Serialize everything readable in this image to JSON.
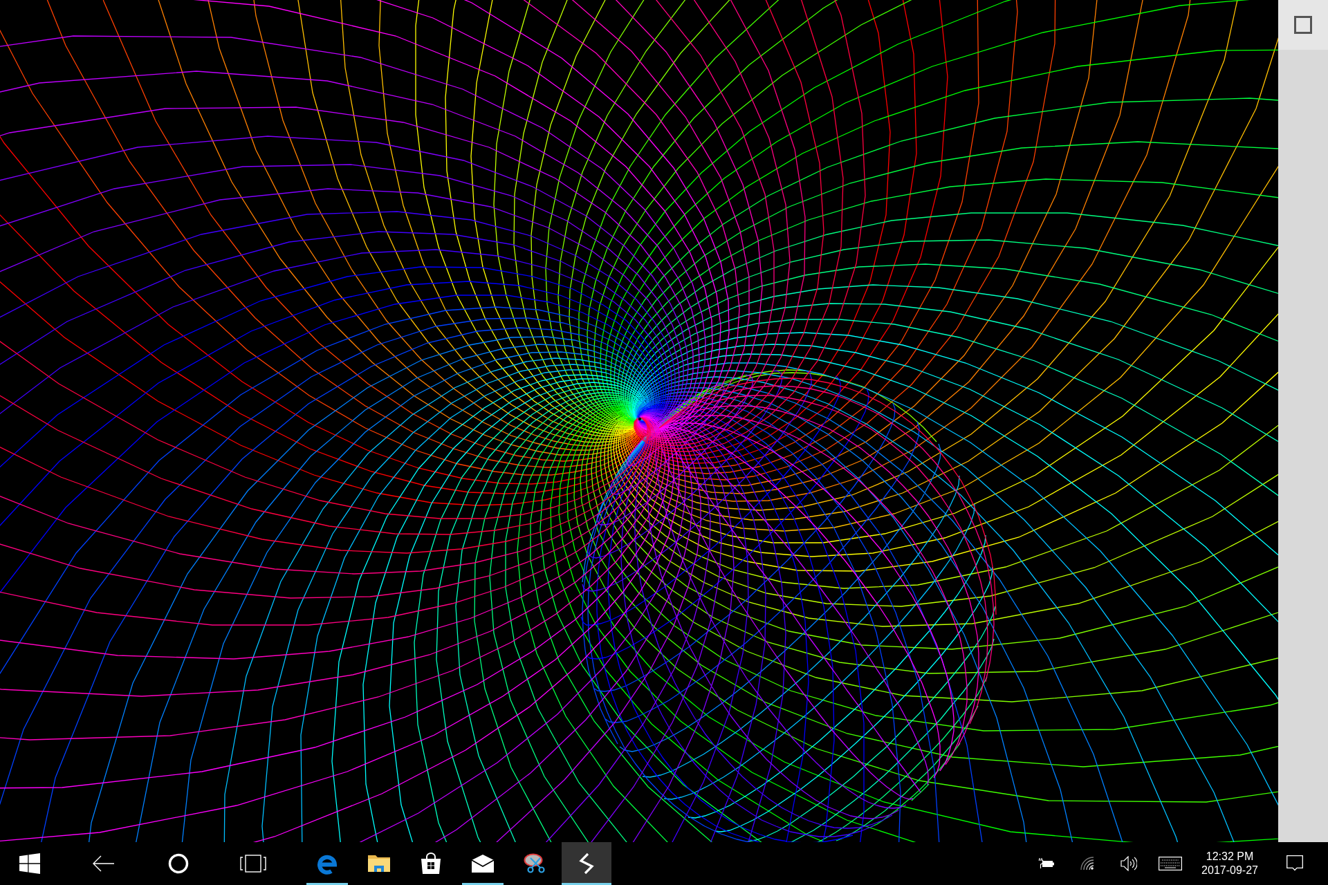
{
  "taskbar": {
    "apps": [
      {
        "running": true,
        "selected": false
      },
      {
        "running": false,
        "selected": false
      },
      {
        "running": false,
        "selected": false
      },
      {
        "running": true,
        "selected": false
      },
      {
        "running": false,
        "selected": false
      },
      {
        "running": true,
        "selected": true
      }
    ],
    "clock": {
      "time": "12:32 PM",
      "date": "2017-09-27"
    }
  }
}
